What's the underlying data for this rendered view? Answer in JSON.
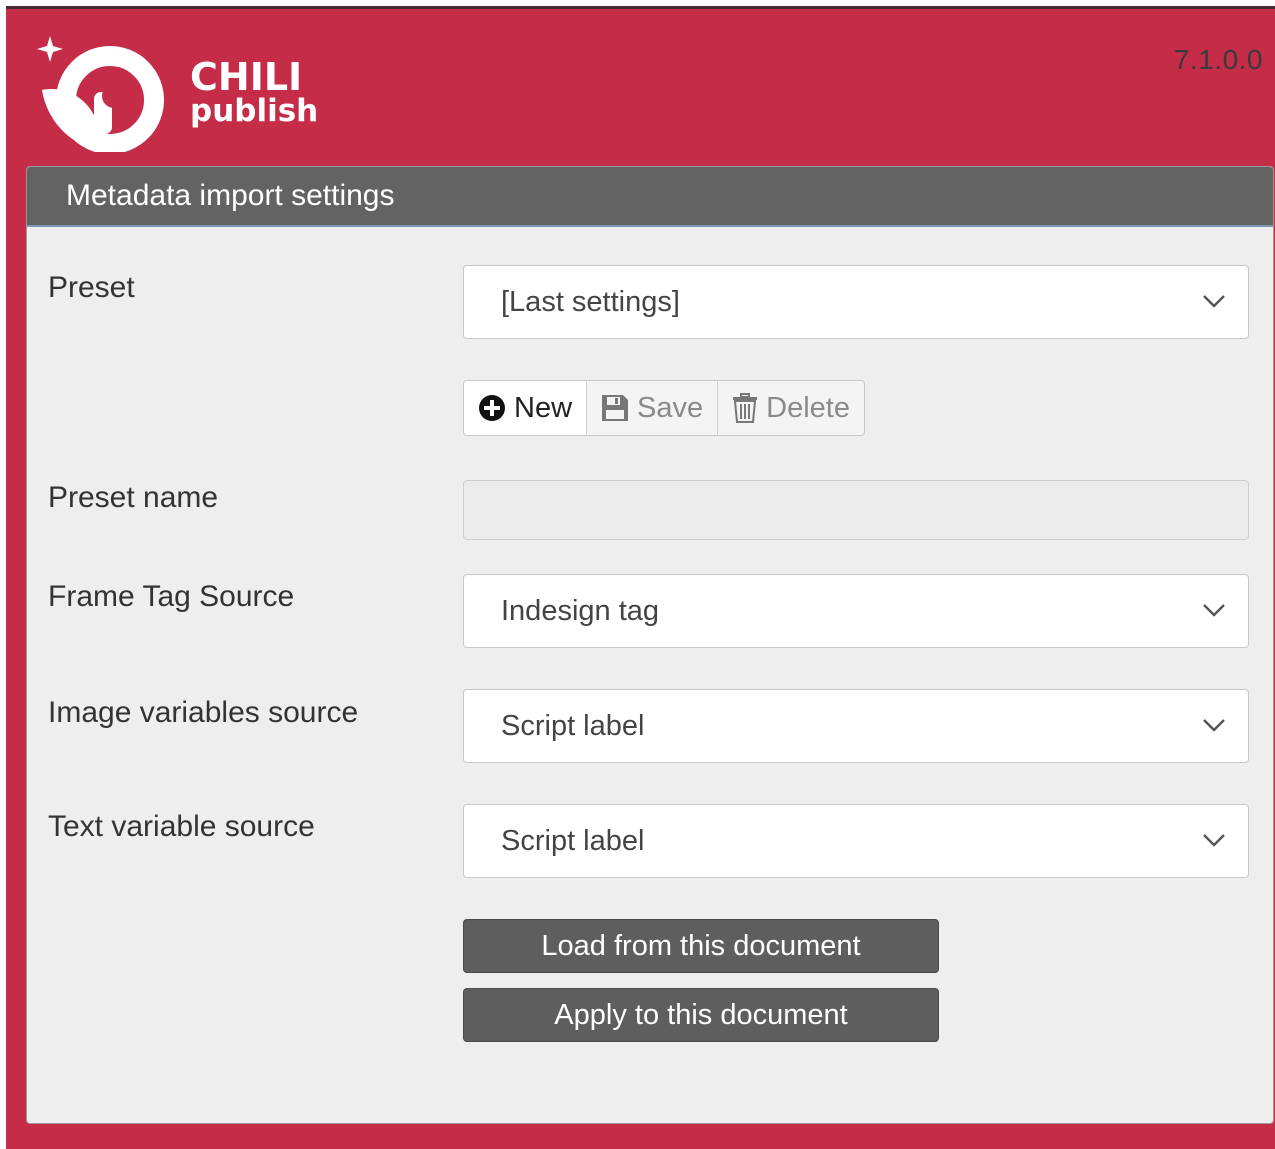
{
  "app": {
    "brand_line1": "CHILI",
    "brand_line2": "publish",
    "version": "7.1.0.0",
    "logo_icon": "chili-publish-logo",
    "accent_color": "#c52c48"
  },
  "panel": {
    "title": "Metadata import settings",
    "preset": {
      "label": "Preset",
      "value": "[Last settings]"
    },
    "preset_actions": {
      "new_label": "New",
      "save_label": "Save",
      "delete_label": "Delete"
    },
    "preset_name": {
      "label": "Preset name",
      "value": ""
    },
    "frame_tag_source": {
      "label": "Frame Tag Source",
      "value": "Indesign tag"
    },
    "image_variables_source": {
      "label": "Image variables source",
      "value": "Script label"
    },
    "text_variable_source": {
      "label": "Text variable source",
      "value": "Script label"
    },
    "load_button_label": "Load from this document",
    "apply_button_label": "Apply to this document"
  }
}
